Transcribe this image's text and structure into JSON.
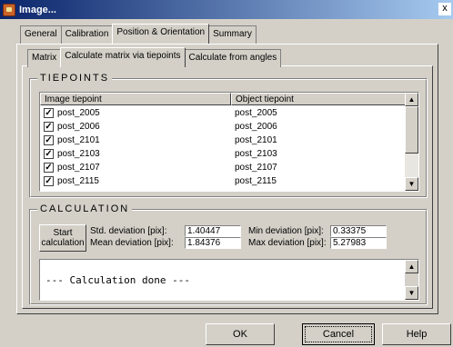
{
  "window": {
    "title": "Image...",
    "close_label": "x"
  },
  "main_tabs": [
    "General",
    "Calibration",
    "Position & Orientation",
    "Summary"
  ],
  "sub_tabs": [
    "Matrix",
    "Calculate matrix via tiepoints",
    "Calculate from angles"
  ],
  "tiepoints": {
    "title": "TIEPOINTS",
    "columns": [
      "Image tiepoint",
      "Object tiepoint"
    ],
    "rows": [
      {
        "image": "post_2005",
        "object": "post_2005",
        "checked": true
      },
      {
        "image": "post_2006",
        "object": "post_2006",
        "checked": true
      },
      {
        "image": "post_2101",
        "object": "post_2101",
        "checked": true
      },
      {
        "image": "post_2103",
        "object": "post_2103",
        "checked": true
      },
      {
        "image": "post_2107",
        "object": "post_2107",
        "checked": true
      },
      {
        "image": "post_2115",
        "object": "post_2115",
        "checked": true
      }
    ]
  },
  "calculation": {
    "title": "CALCULATION",
    "start_label_1": "Start",
    "start_label_2": "calculation",
    "std_label": "Std. deviation [pix]:",
    "std_value": "1.40447",
    "mean_label": "Mean deviation [pix]:",
    "mean_value": "1.84376",
    "min_label": "Min deviation [pix]:",
    "min_value": "0.33375",
    "max_label": "Max deviation [pix]:",
    "max_value": "5.27983",
    "output": "--- Calculation done ---"
  },
  "buttons": {
    "ok": "OK",
    "cancel": "Cancel",
    "help": "Help"
  },
  "icons": {
    "checkbox": "check-icon",
    "scroll_up": "arrow-up-icon",
    "scroll_down": "arrow-down-icon"
  }
}
